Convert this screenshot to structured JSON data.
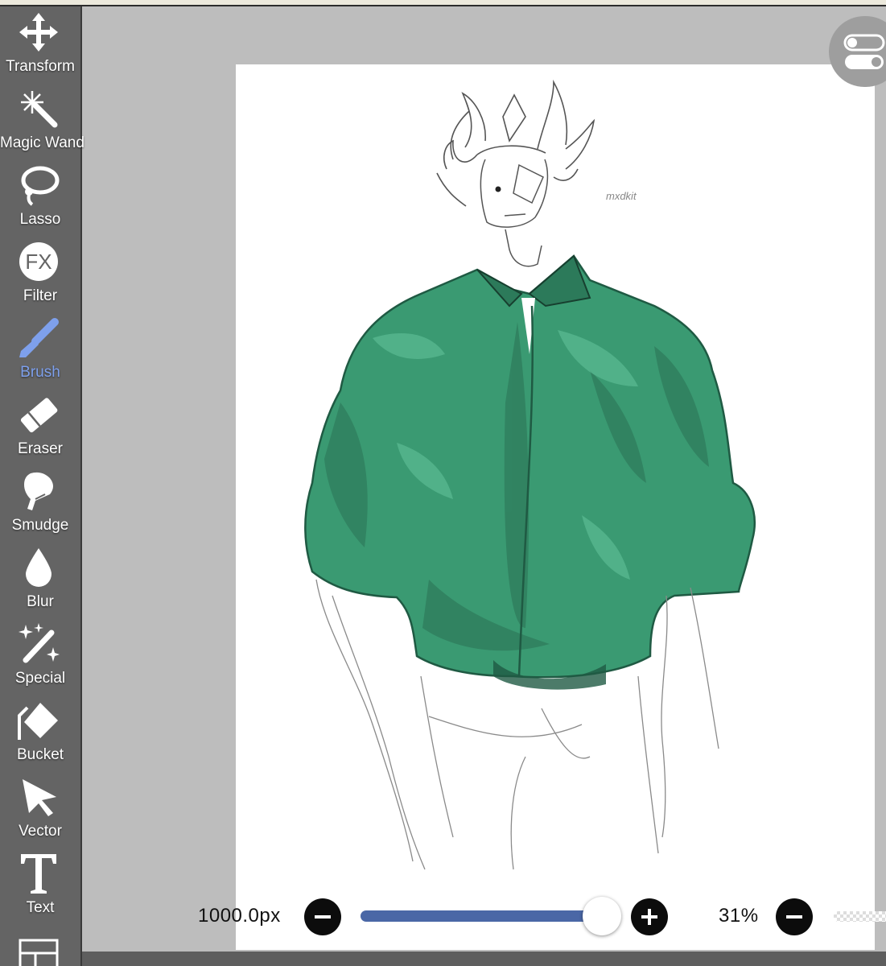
{
  "toolbar": {
    "tools": [
      {
        "label": "Transform"
      },
      {
        "label": "Magic Wand"
      },
      {
        "label": "Lasso"
      },
      {
        "label": "Filter"
      },
      {
        "label": "Brush"
      },
      {
        "label": "Eraser"
      },
      {
        "label": "Smudge"
      },
      {
        "label": "Blur"
      },
      {
        "label": "Special"
      },
      {
        "label": "Bucket"
      },
      {
        "label": "Vector"
      },
      {
        "label": "Text"
      }
    ],
    "active_tool": "Brush",
    "filter_icon_text": "FX"
  },
  "canvas": {
    "signature": "mxdkit"
  },
  "bottom_controls": {
    "brush_size": "1000.0px",
    "brush_size_slider_fraction": 1.0,
    "zoom": "31%"
  },
  "colors": {
    "toolbar_bg": "#646464",
    "active_tool": "#7ea0ec",
    "slider_fill": "#4a67a6",
    "shirt_green": "#3a9a72",
    "canvas_bg": "#bdbdbd"
  }
}
